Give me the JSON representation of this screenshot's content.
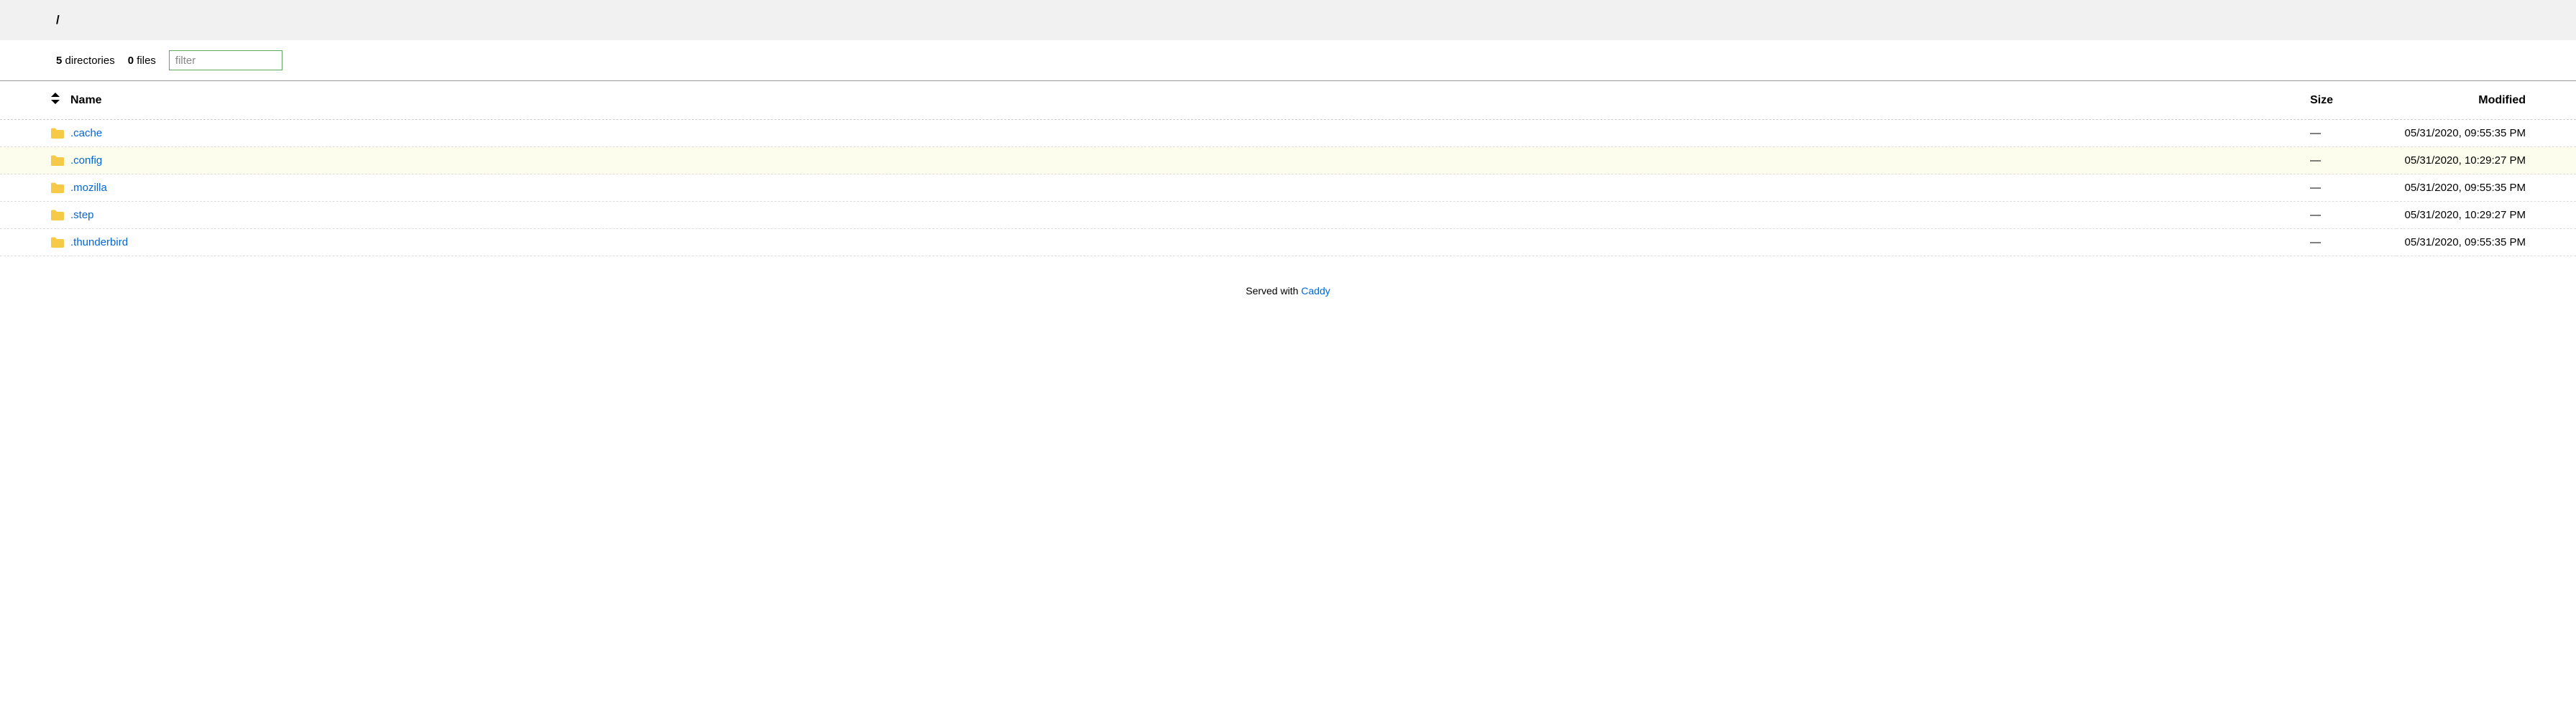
{
  "breadcrumb": "/",
  "counts": {
    "directories_count": "5",
    "directories_label": "directories",
    "files_count": "0",
    "files_label": "files"
  },
  "filter": {
    "placeholder": "filter",
    "value": ""
  },
  "headers": {
    "name": "Name",
    "size": "Size",
    "modified": "Modified"
  },
  "rows": [
    {
      "name": ".cache",
      "size": "—",
      "modified": "05/31/2020, 09:55:35 PM",
      "highlight": false
    },
    {
      "name": ".config",
      "size": "—",
      "modified": "05/31/2020, 10:29:27 PM",
      "highlight": true
    },
    {
      "name": ".mozilla",
      "size": "—",
      "modified": "05/31/2020, 09:55:35 PM",
      "highlight": false
    },
    {
      "name": ".step",
      "size": "—",
      "modified": "05/31/2020, 10:29:27 PM",
      "highlight": false
    },
    {
      "name": ".thunderbird",
      "size": "—",
      "modified": "05/31/2020, 09:55:35 PM",
      "highlight": false
    }
  ],
  "footer": {
    "prefix": "Served with ",
    "link_text": "Caddy"
  }
}
